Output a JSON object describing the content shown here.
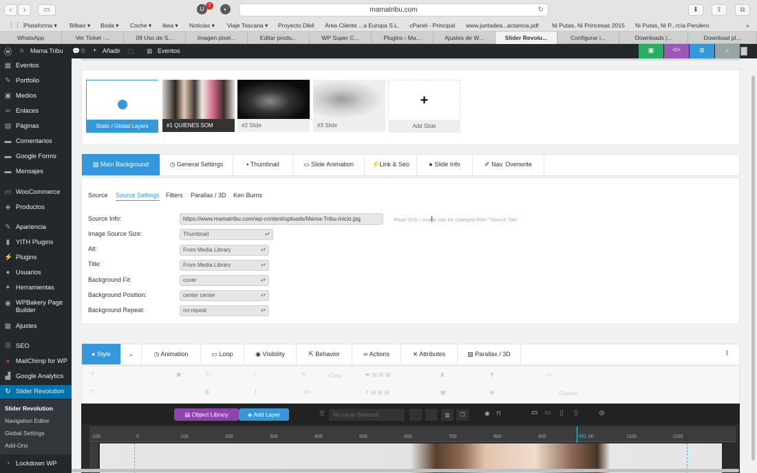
{
  "browser": {
    "url": "mamatribu.com",
    "badge": "7",
    "bookmarks": [
      "Plataforma ▾",
      "Bilbao ▾",
      "Boda ▾",
      "Coche ▾",
      "Ikea ▾",
      "Noticias ▾",
      "Viaje Toscana ▾",
      "Proyecto Dikê",
      "Área Cliente ...a Europa S.L.",
      "cPanel - Principal",
      "www.juntadea...actancia.pdf",
      "Ni Putas, Ni Princesas 2015",
      "Ni Putas, Ni P...rcía Perulero"
    ],
    "tabs": [
      "WhatsApp",
      "Ver Ticket -...",
      "09 Uso de S...",
      "Imagen pixel...",
      "Editar produ...",
      "WP Super C...",
      "Plugins ‹ Ma...",
      "Ajustes de W...",
      "Slider Revolu...",
      "Configurar i...",
      "Downloads |...",
      "Download pl..."
    ],
    "active_tab_index": 8
  },
  "adminbar": {
    "site": "Mama Tribu",
    "comments": "0",
    "add": "Añadir",
    "events": "Eventos"
  },
  "sidebar": {
    "items": [
      "Eventos",
      "Portfolio",
      "Medios",
      "Enlaces",
      "Páginas",
      "Comentarios",
      "Google Forms",
      "Mensajes",
      "WooCommerce",
      "Productos",
      "Apariencia",
      "YITH Plugins",
      "Plugins",
      "Usuarios",
      "Herramientas",
      "WPBakery Page Builder",
      "Ajustes",
      "SEO",
      "MailChimp for WP",
      "Google Analytics",
      "Slider Revolution",
      "Lockdown WP"
    ],
    "submenu": [
      "Slider Revolution",
      "Navigation Editor",
      "Global Settings",
      "Add-Ons"
    ]
  },
  "slides": {
    "static": "Static / Global Layers",
    "items": [
      {
        "num": "#1",
        "label": "QUIENES SOM"
      },
      {
        "num": "#2",
        "label": "Slide"
      },
      {
        "num": "#3",
        "label": "Slide"
      }
    ],
    "add": "Add Slide"
  },
  "main_tabs": [
    "Main Background",
    "General Settings",
    "Thumbnail",
    "Slide Animation",
    "Link & Seo",
    "Slide Info",
    "Nav. Overwrite"
  ],
  "sub_tabs": [
    "Source",
    "Source Settings",
    "Filters",
    "Parallax / 3D",
    "Ken Burns"
  ],
  "fields": {
    "source_info_label": "Source Info:",
    "source_info_value": "https://www.mamatribu.com/wp-content/uploads/Mama-Tribu-inicio.jpg",
    "source_info_note": "Read Only ! Image can be changed from \"Source Tab\"",
    "image_source_size_label": "Image Source Size:",
    "image_source_size": "Thumbnail",
    "alt_label": "Alt:",
    "alt": "From Media Library",
    "title_label": "Title:",
    "title": "From Media Library",
    "bg_fit_label": "Background Fit:",
    "bg_fit": "cover",
    "bg_position_label": "Background Position:",
    "bg_position": "center center",
    "bg_repeat_label": "Background Repeat:",
    "bg_repeat": "no-repeat"
  },
  "layer_tabs": [
    "Style",
    "Animation",
    "Loop",
    "Visibility",
    "Behavior",
    "Actions",
    "Attributes",
    "Parallax / 3D"
  ],
  "layer_ghost": [
    "Color",
    "X",
    "Y",
    "Custom"
  ],
  "editor": {
    "object_library": "Object Library",
    "add_layer": "Add Layer",
    "no_layer": "No Layer Selected",
    "ruler": [
      "-100",
      "0",
      "100",
      "200",
      "300",
      "400",
      "500",
      "600",
      "700",
      "800",
      "900",
      "991",
      "00",
      "1100",
      "1200"
    ]
  }
}
